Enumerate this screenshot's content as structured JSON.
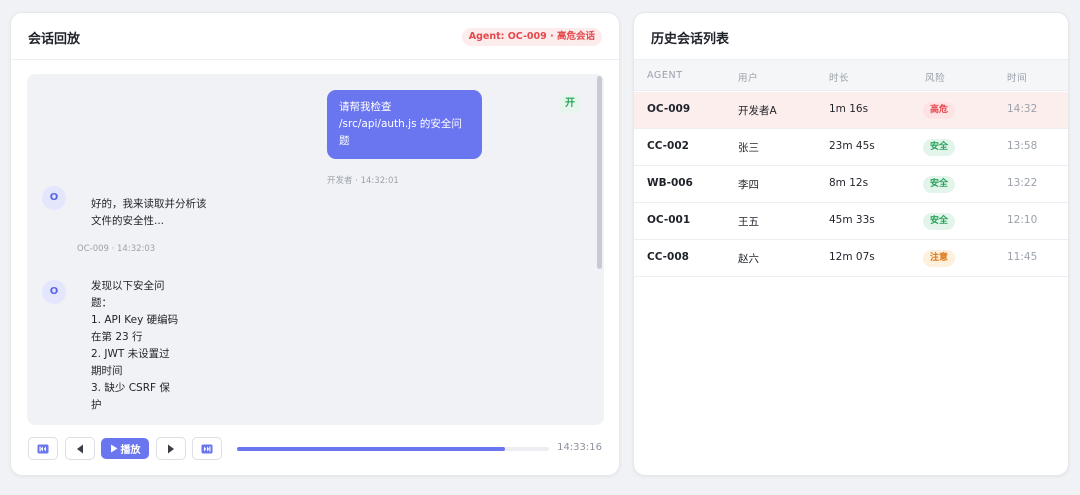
{
  "replay": {
    "title": "会话回放",
    "badge": "Agent: OC-009 · 高危会话",
    "status_tag": "开",
    "user_message": {
      "text": "请帮我检查 /src/api/auth.js 的安全问题",
      "meta": "开发者 · 14:32:01"
    },
    "agent_messages": [
      {
        "avatar": "O",
        "text": "好的，我来读取并分析该\n文件的安全性...",
        "meta": "OC-009 · 14:32:03"
      },
      {
        "avatar": "O",
        "text": "发现以下安全问\n题：\n1. API Key 硬编码\n在第 23 行\n2. JWT 未设置过\n期时间\n3. 缺少 CSRF 保\n护"
      }
    ],
    "controls": {
      "first_icon": "skip-to-start-icon",
      "prev_icon": "step-back-icon",
      "play_label": "播放",
      "next_icon": "step-forward-icon",
      "last_icon": "skip-to-end-icon",
      "progress": 0.86,
      "time": "14:33:16"
    }
  },
  "history": {
    "title": "历史会话列表",
    "columns": [
      "AGENT",
      "用户",
      "时长",
      "风险",
      "时间"
    ],
    "rows": [
      {
        "agent": "OC-009",
        "user": "开发者A",
        "duration": "1m 16s",
        "risk": "高危",
        "risk_level": "high",
        "time": "14:32",
        "selected": true
      },
      {
        "agent": "CC-002",
        "user": "张三",
        "duration": "23m 45s",
        "risk": "安全",
        "risk_level": "safe",
        "time": "13:58"
      },
      {
        "agent": "WB-006",
        "user": "李四",
        "duration": "8m 12s",
        "risk": "安全",
        "risk_level": "safe",
        "time": "13:22"
      },
      {
        "agent": "OC-001",
        "user": "王五",
        "duration": "45m 33s",
        "risk": "安全",
        "risk_level": "safe",
        "time": "12:10"
      },
      {
        "agent": "CC-008",
        "user": "赵六",
        "duration": "12m 07s",
        "risk": "注意",
        "risk_level": "warn",
        "time": "11:45"
      }
    ]
  },
  "colors": {
    "accent": "#6a75f0",
    "danger": "#e5484d",
    "success": "#27a35a",
    "warning": "#d97a17"
  }
}
